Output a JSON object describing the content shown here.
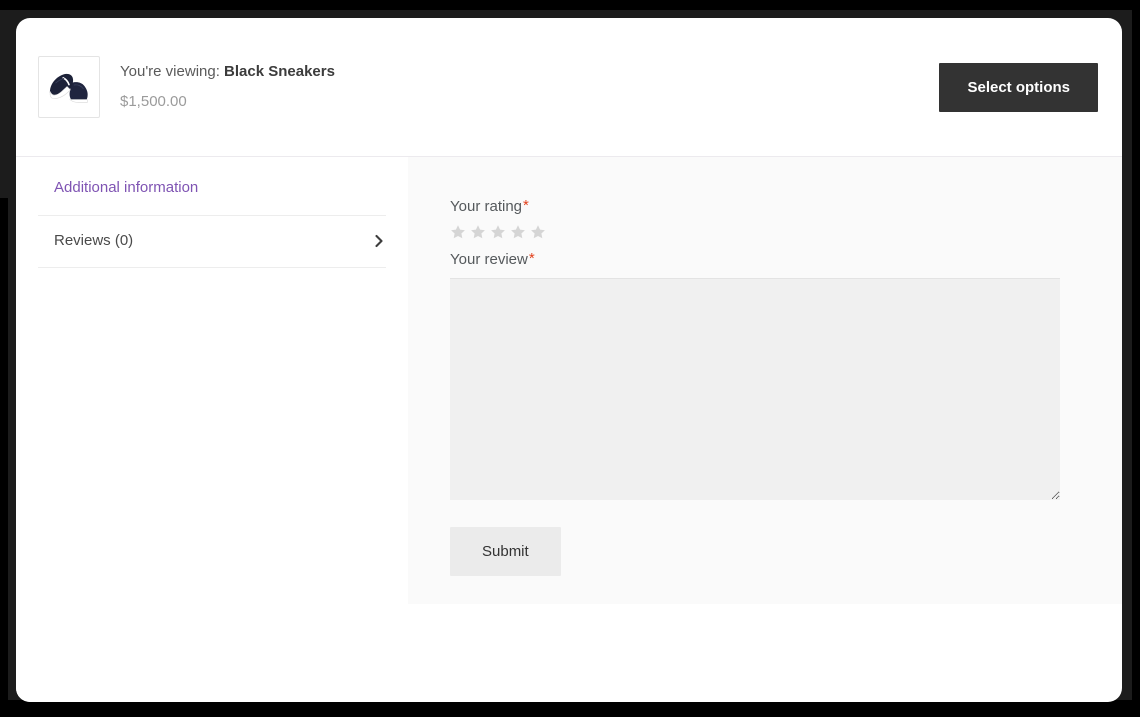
{
  "product_bar": {
    "viewing_prefix": "You're viewing:",
    "product_name": "Black Sneakers",
    "price": "$1,500.00",
    "thumbnail_alt": "black-sneakers-thumbnail",
    "select_options_label": "Select options"
  },
  "side_nav": {
    "items": [
      {
        "label": "Additional information",
        "active": true,
        "has_chevron": false
      },
      {
        "label": "Reviews (0)",
        "active": false,
        "has_chevron": true
      }
    ]
  },
  "review_form": {
    "rating_label": "Your rating",
    "rating_required_mark": "*",
    "rating_value": 0,
    "star_count": 5,
    "review_label": "Your review",
    "review_required_mark": "*",
    "review_value": "",
    "review_placeholder": "",
    "submit_label": "Submit"
  },
  "colors": {
    "accent_purple": "#7f54b3",
    "button_dark": "#333333",
    "required_red": "#e2401c",
    "star_empty": "#d5d5d5",
    "panel_bg": "#fafafa",
    "textarea_bg": "#f0f0f0",
    "submit_bg": "#ebebeb",
    "page_black": "#000000",
    "frame_dark": "#1c1c1c"
  }
}
